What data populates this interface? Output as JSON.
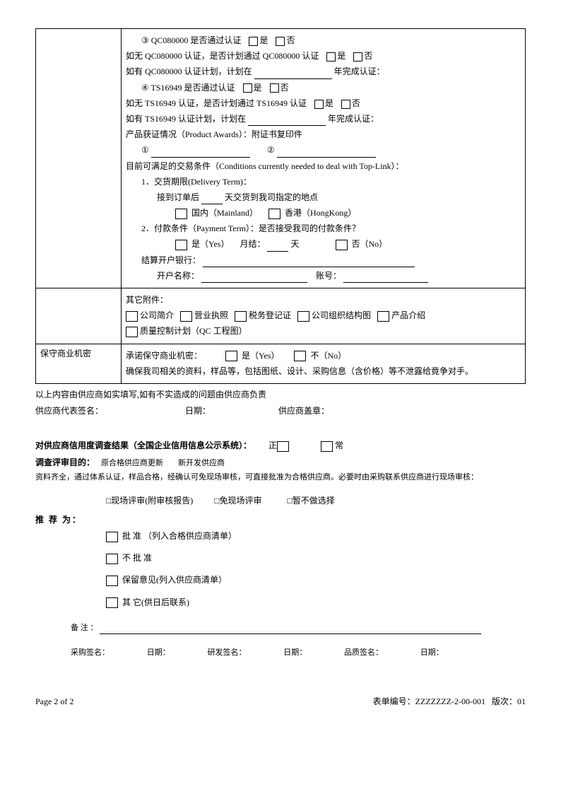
{
  "cert": {
    "qc_q": "③ QC080000 是否通过认证",
    "yes": "是",
    "no": "否",
    "qc_no_plan": "如无 QC080000 认证，是否计划通过 QC080000 认证",
    "qc_has_plan_pre": "如有 QC080000 认证计划，计划在",
    "year_complete": "年完成认证：",
    "ts_q": "④ TS16949 是否通过认证",
    "ts_no_plan": "如无 TS16949 认证，是否计划通过 TS16949 认证",
    "ts_has_plan_pre": "如有 TS16949 认证计划，计划在",
    "awards": "产品获证情况（Product Awards）：附证书复印件",
    "num1": "①",
    "num2": "②",
    "conditions": "目前可满足的交易条件（Conditions currently needed to deal with Top-Link）：",
    "delivery_label": "1．交货期限(Delivery Term)：",
    "delivery_pre": "接到订单后",
    "delivery_post": "天交货到我司指定的地点",
    "mainland": "国内（Mainland）",
    "hongkong": "香港（HongKong）",
    "payment_label": "2．付款条件（Payment Term）：是否接受我司的付款条件？",
    "pay_yes": "是（Yes）",
    "monthly": "月结：",
    "days": "天",
    "pay_no": "否（No）",
    "bank": "结算开户银行：",
    "acct_name": "开户名称：",
    "acct_no": "账号：",
    "attach_title": "其它附件：",
    "att1": "公司简介",
    "att2": "营业执照",
    "att3": "税务登记证",
    "att4": "公司组织结构图",
    "att5": "产品介绍",
    "att6": "质量控制计划（QC 工程图）"
  },
  "secret": {
    "label": "保守商业机密",
    "promise": "承诺保守商业机密：",
    "yes": "是（Yes）",
    "no": "不（No）",
    "note": "确保我司相关的资料，样品等，包括图纸、设计、采购信息（含价格）等不泄露给竟争对手。"
  },
  "after": {
    "truth": "以上内容由供应商如实填写,如有不实造成的问题由供应商负责",
    "rep_sig": "供应商代表签名：",
    "date": "日期：",
    "stamp": "供应商盖章："
  },
  "credit": {
    "title_pre": "对供应商信用度调查结果（",
    "title_bold": "全国企业信用信息公示系统",
    "title_post": "）：",
    "normal": "正",
    "abnormal": "常",
    "purpose_label": "调查评审目的：",
    "opt1": "原合格供应商更新",
    "opt2": "新开发供应商",
    "note": "资料齐全，通过体系认证，样品合格，经确认可免现场审核，可直接批准为合格供应商。必要时由采购联系供应商进行现场审核：",
    "onsite": "□现场评审(附审核报告)",
    "offsite": "□免现场评审",
    "defer": "□暂不做选择"
  },
  "rec": {
    "label": "推 荐 为：",
    "r1": "批  准 （列入合格供应商清单）",
    "r2": "不 批 准",
    "r3": "保留意见(列入供应商清单）",
    "r4": "其 它(供日后联系)",
    "remark": "备 注   ："
  },
  "sigs": {
    "buy": "采购签名：",
    "date": "日期：",
    "rd": "研发签名：",
    "qa": "品质签名："
  },
  "footer": {
    "page": "Page 2 of 2",
    "form_no_label": "表单编号：",
    "form_no": "ZZZZZZZ-2-00-001",
    "rev_label": "版次：",
    "rev": "01"
  }
}
